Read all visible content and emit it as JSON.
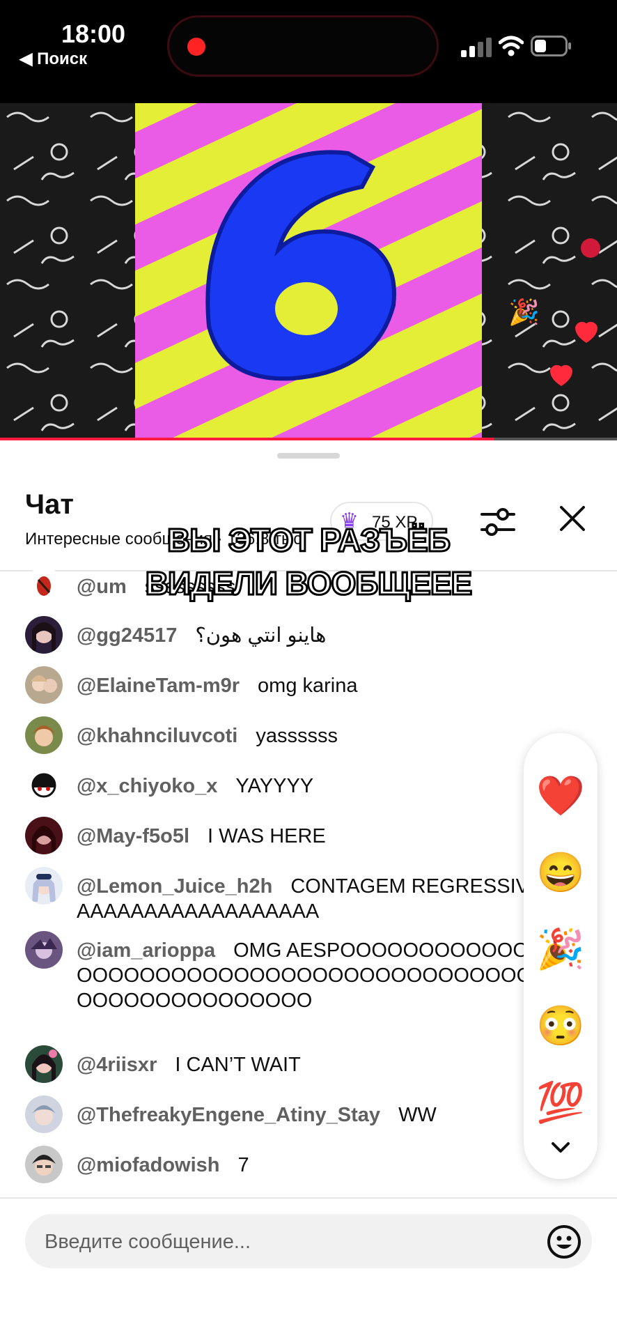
{
  "status_bar": {
    "time": "18:00",
    "back_label": "◀ Поиск"
  },
  "colors": {
    "accent_red": "#ff1a40",
    "crown_purple": "#8a3cf2"
  },
  "video": {
    "countdown_number": "6",
    "progress_fraction": 0.8
  },
  "chat": {
    "title": "Чат",
    "subtitle": "Интересные сообщения · 136,8 тыс.",
    "xp_label": "75 XP",
    "icons": [
      "crown-icon",
      "filter-sliders-icon",
      "close-icon"
    ]
  },
  "caption": {
    "line1": "ВЫ ЭТОТ РАЗЪЁБ",
    "line2": "ВИДЕЛИ ВООБЩЕЕЕ"
  },
  "messages": [
    {
      "author": "@um",
      "text": "sssssssss"
    },
    {
      "author": "@gg24517",
      "text": "هاينو انتي هون؟"
    },
    {
      "author": "@ElaineTam-m9r",
      "text": "omg karina"
    },
    {
      "author": "@khahnciluvcoti",
      "text": "yassssss"
    },
    {
      "author": "@x_chiyoko_x",
      "text": "YAYYYY"
    },
    {
      "author": "@May-f5o5l",
      "text": "I WAS HERE"
    },
    {
      "author": "@Lemon_Juice_h2h",
      "text": "CONTAGEM REGRESSIVAAAAAAAAAAAAAAAAAAAAAA"
    },
    {
      "author": "@iam_arioppa",
      "text": "OMG AESPOOOOOOOOOOOOOOOOOOOOOOOOOOOOOOOOOOOOOOOOOOOOOOOOOOOOOOOOOOOOOOO"
    },
    {
      "author": "@4riisxr",
      "text": "I CAN’T WAIT"
    },
    {
      "author": "@ThefreakyEngene_Atiny_Stay",
      "text": "WW"
    },
    {
      "author": "@miofadowish",
      "text": "7"
    }
  ],
  "reactions": [
    "❤️",
    "😄",
    "🎉",
    "😳",
    "💯"
  ],
  "input": {
    "placeholder": "Введите сообщение..."
  }
}
